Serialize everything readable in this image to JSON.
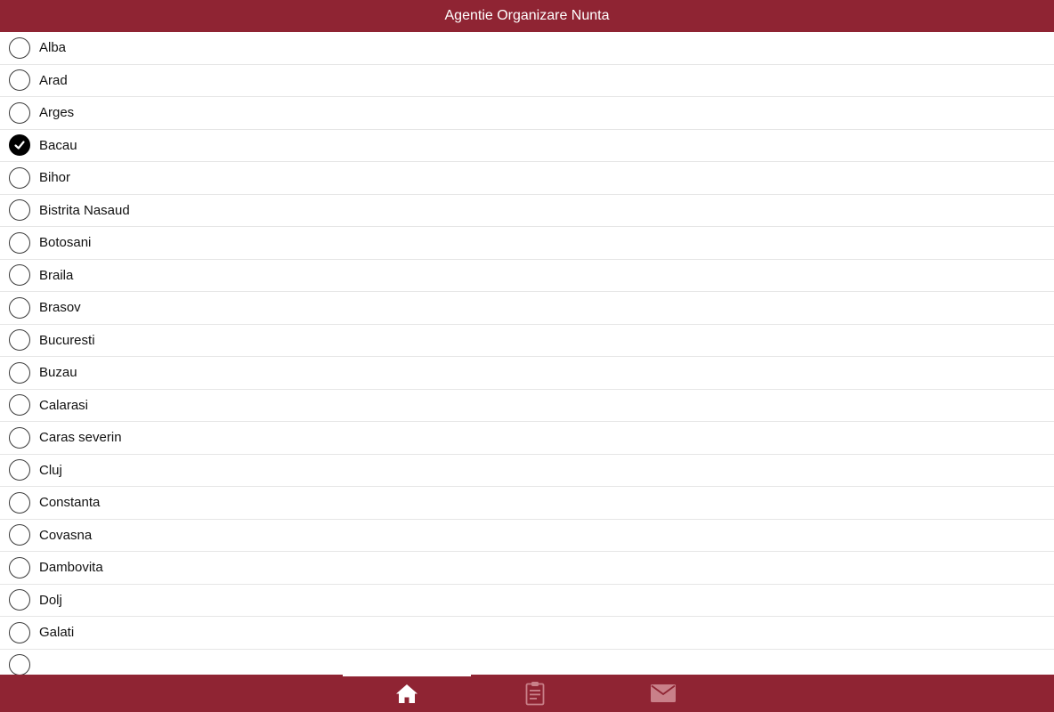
{
  "header": {
    "title": "Agentie Organizare Nunta"
  },
  "list": {
    "items": [
      {
        "label": "Alba",
        "checked": false
      },
      {
        "label": "Arad",
        "checked": false
      },
      {
        "label": "Arges",
        "checked": false
      },
      {
        "label": "Bacau",
        "checked": true
      },
      {
        "label": "Bihor",
        "checked": false
      },
      {
        "label": "Bistrita Nasaud",
        "checked": false
      },
      {
        "label": "Botosani",
        "checked": false
      },
      {
        "label": "Braila",
        "checked": false
      },
      {
        "label": "Brasov",
        "checked": false
      },
      {
        "label": "Bucuresti",
        "checked": false
      },
      {
        "label": "Buzau",
        "checked": false
      },
      {
        "label": "Calarasi",
        "checked": false
      },
      {
        "label": "Caras severin",
        "checked": false
      },
      {
        "label": "Cluj",
        "checked": false
      },
      {
        "label": "Constanta",
        "checked": false
      },
      {
        "label": "Covasna",
        "checked": false
      },
      {
        "label": "Dambovita",
        "checked": false
      },
      {
        "label": "Dolj",
        "checked": false
      },
      {
        "label": "Galati",
        "checked": false
      },
      {
        "label": "",
        "checked": false
      }
    ]
  },
  "bottom_nav": {
    "tabs": [
      {
        "icon": "home-icon",
        "active": true
      },
      {
        "icon": "clipboard-icon",
        "active": false
      },
      {
        "icon": "mail-icon",
        "active": false
      }
    ]
  },
  "colors": {
    "brand": "#8f2433",
    "header_text": "#ffffff",
    "checked_fill": "#000000",
    "divider": "#e6e6e6",
    "inactive_icon": "#c98089"
  }
}
